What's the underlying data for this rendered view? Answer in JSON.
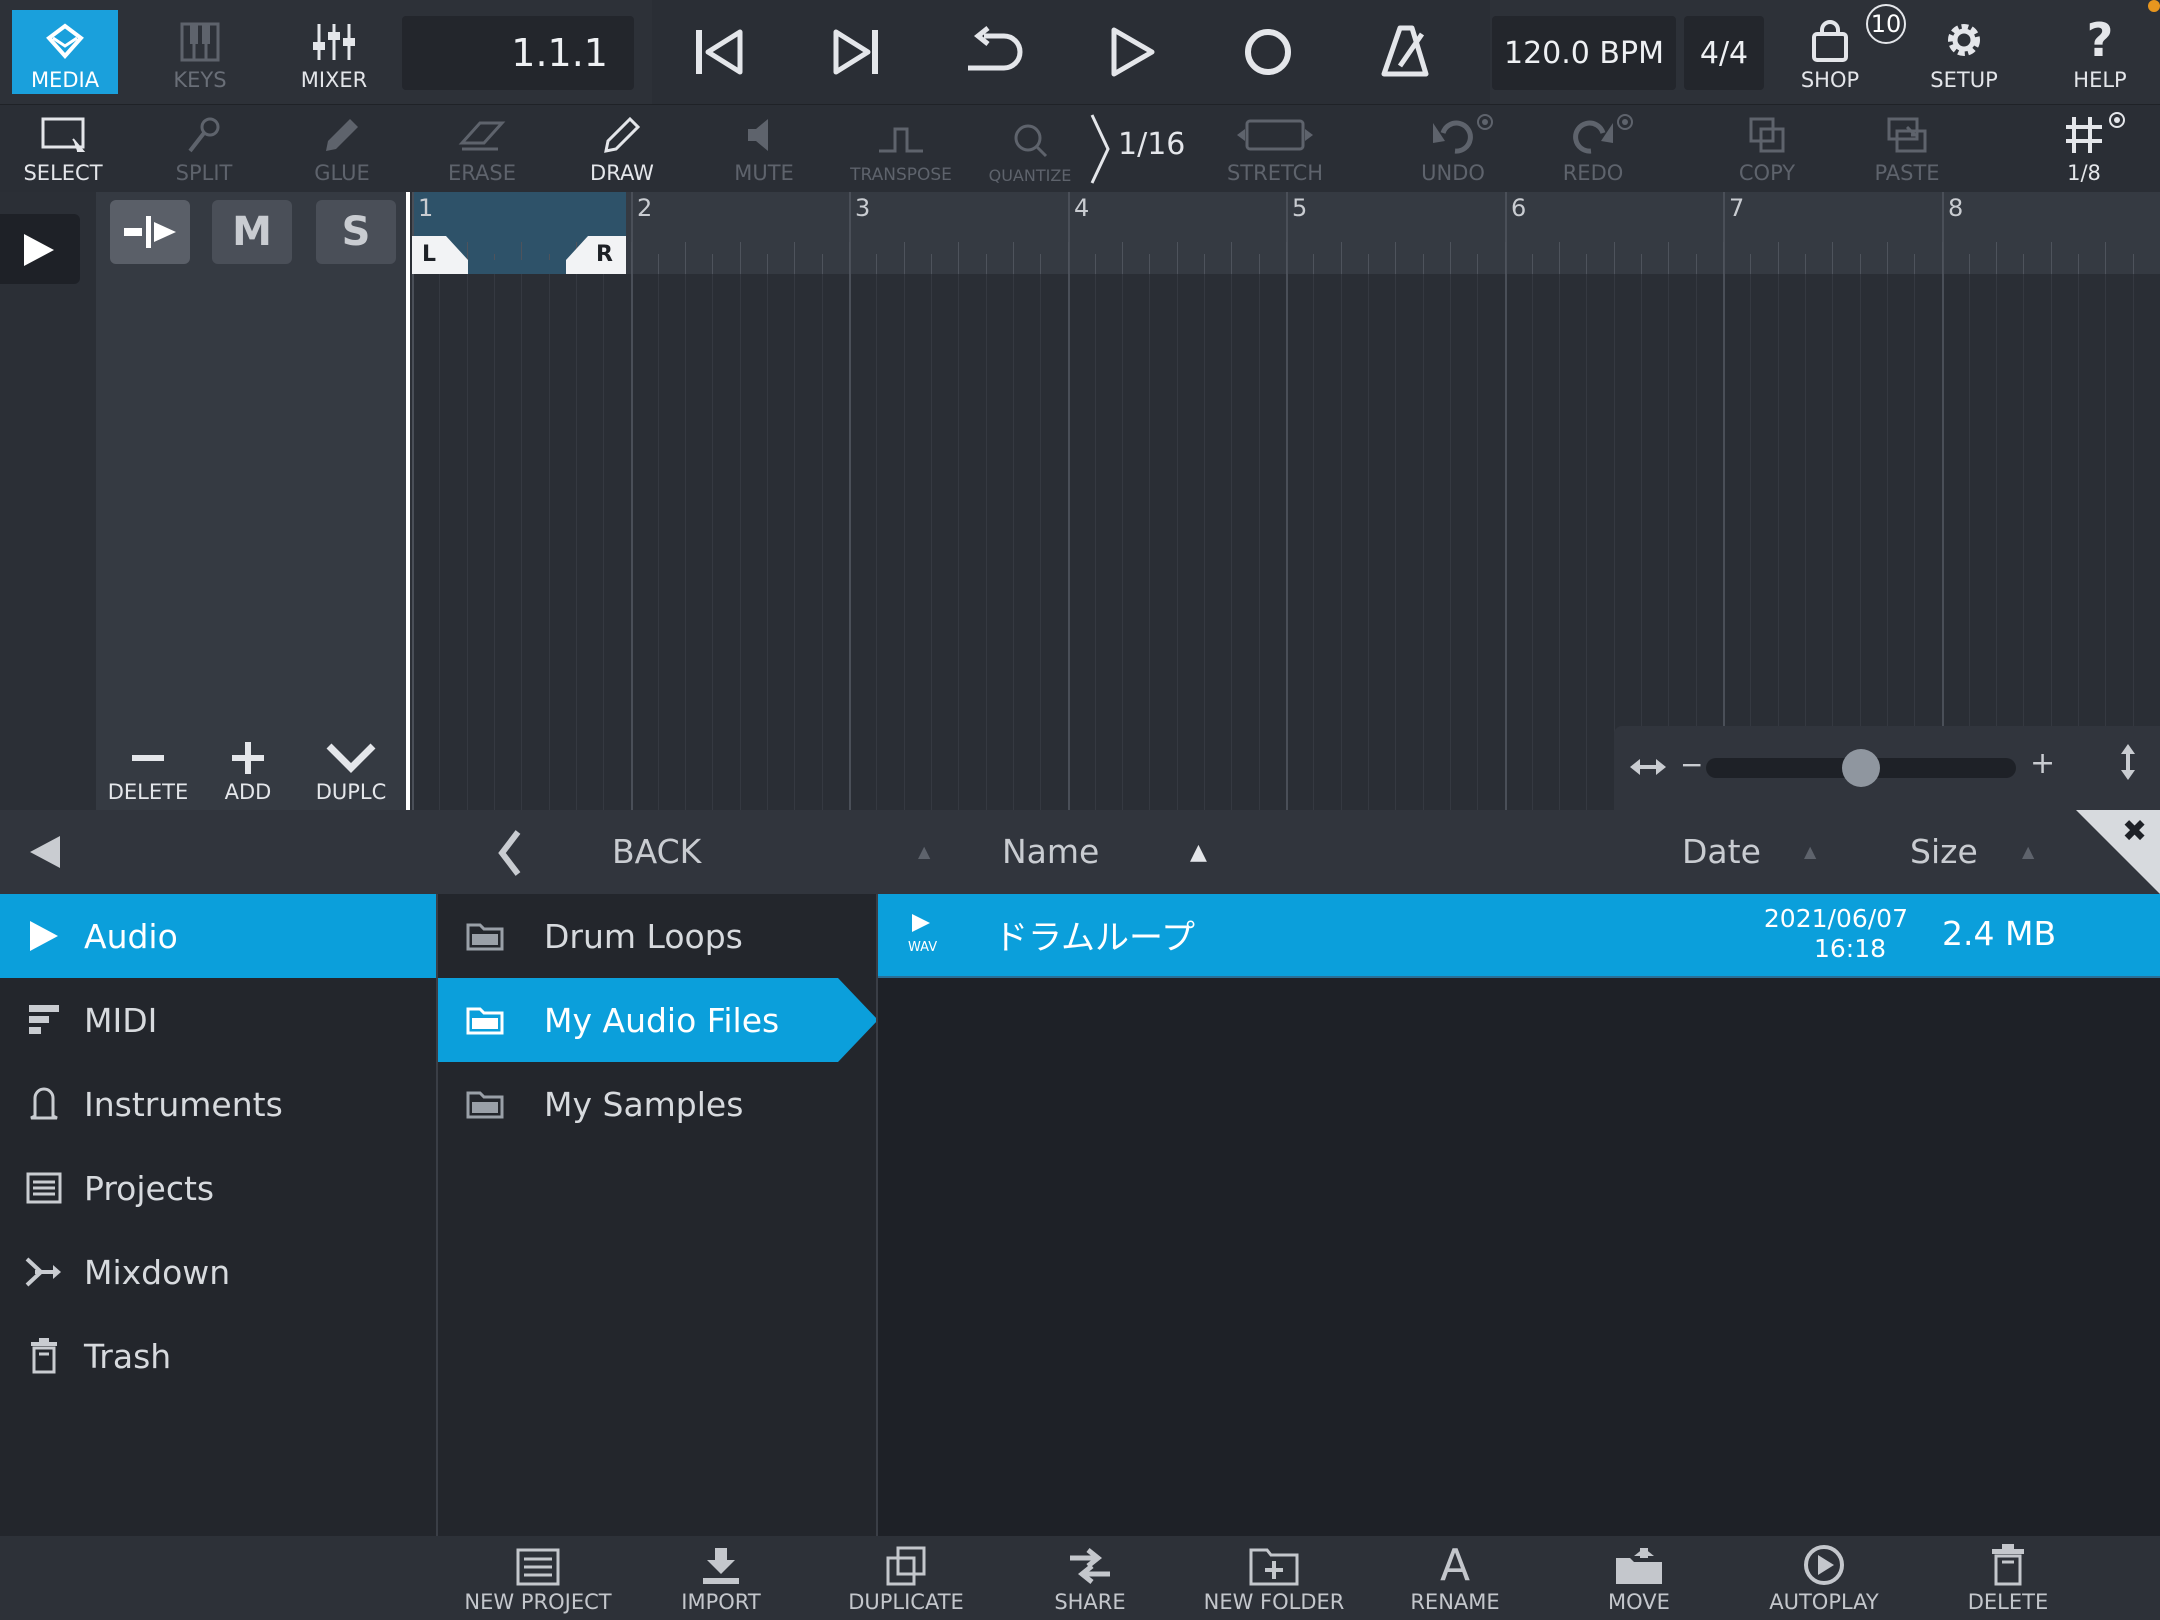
{
  "topbar": {
    "media": "MEDIA",
    "keys": "KEYS",
    "mixer": "MIXER",
    "position": "1.1.1",
    "tempo": "120.0 BPM",
    "signature": "4/4",
    "shop": "SHOP",
    "shop_badge": "10",
    "setup": "SETUP",
    "help": "HELP"
  },
  "toolbar": {
    "select": "SELECT",
    "split": "SPLIT",
    "glue": "GLUE",
    "erase": "ERASE",
    "draw": "DRAW",
    "mute": "MUTE",
    "transpose": "TRANSPOSE",
    "quantize": "QUANTIZE",
    "quantize_value": "1/16",
    "stretch": "STRETCH",
    "undo": "UNDO",
    "redo": "REDO",
    "copy": "COPY",
    "paste": "PASTE",
    "grid_value": "1/8"
  },
  "track_panel": {
    "mute": "M",
    "solo": "S",
    "delete": "DELETE",
    "add": "ADD",
    "duplicate": "DUPLC"
  },
  "timeline": {
    "bars": [
      "1",
      "2",
      "3",
      "4",
      "5",
      "6",
      "7",
      "8"
    ],
    "loop_left": "L",
    "loop_right": "R",
    "zoom_level": 0.5
  },
  "browser": {
    "back": "BACK",
    "columns": {
      "name": "Name",
      "date": "Date",
      "size": "Size"
    },
    "categories": [
      {
        "label": "Audio",
        "icon": "play-icon"
      },
      {
        "label": "MIDI",
        "icon": "midi-icon"
      },
      {
        "label": "Instruments",
        "icon": "bell-icon"
      },
      {
        "label": "Projects",
        "icon": "list-icon"
      },
      {
        "label": "Mixdown",
        "icon": "mixdown-icon"
      },
      {
        "label": "Trash",
        "icon": "trash-icon"
      }
    ],
    "folders": [
      "Drum Loops",
      "My Audio Files",
      "My Samples"
    ],
    "files": [
      {
        "type": "WAV",
        "name": "ドラムループ",
        "date": "2021/06/07",
        "time": "16:18",
        "size": "2.4 MB"
      }
    ]
  },
  "bottombar": {
    "new_project": "NEW PROJECT",
    "import": "IMPORT",
    "duplicate": "DUPLICATE",
    "share": "SHARE",
    "new_folder": "NEW FOLDER",
    "rename": "RENAME",
    "move": "MOVE",
    "autoplay": "AUTOPLAY",
    "delete": "DELETE"
  },
  "colors": {
    "accent": "#0b9fdb",
    "background": "#1e2127",
    "panel": "#2d3138"
  }
}
